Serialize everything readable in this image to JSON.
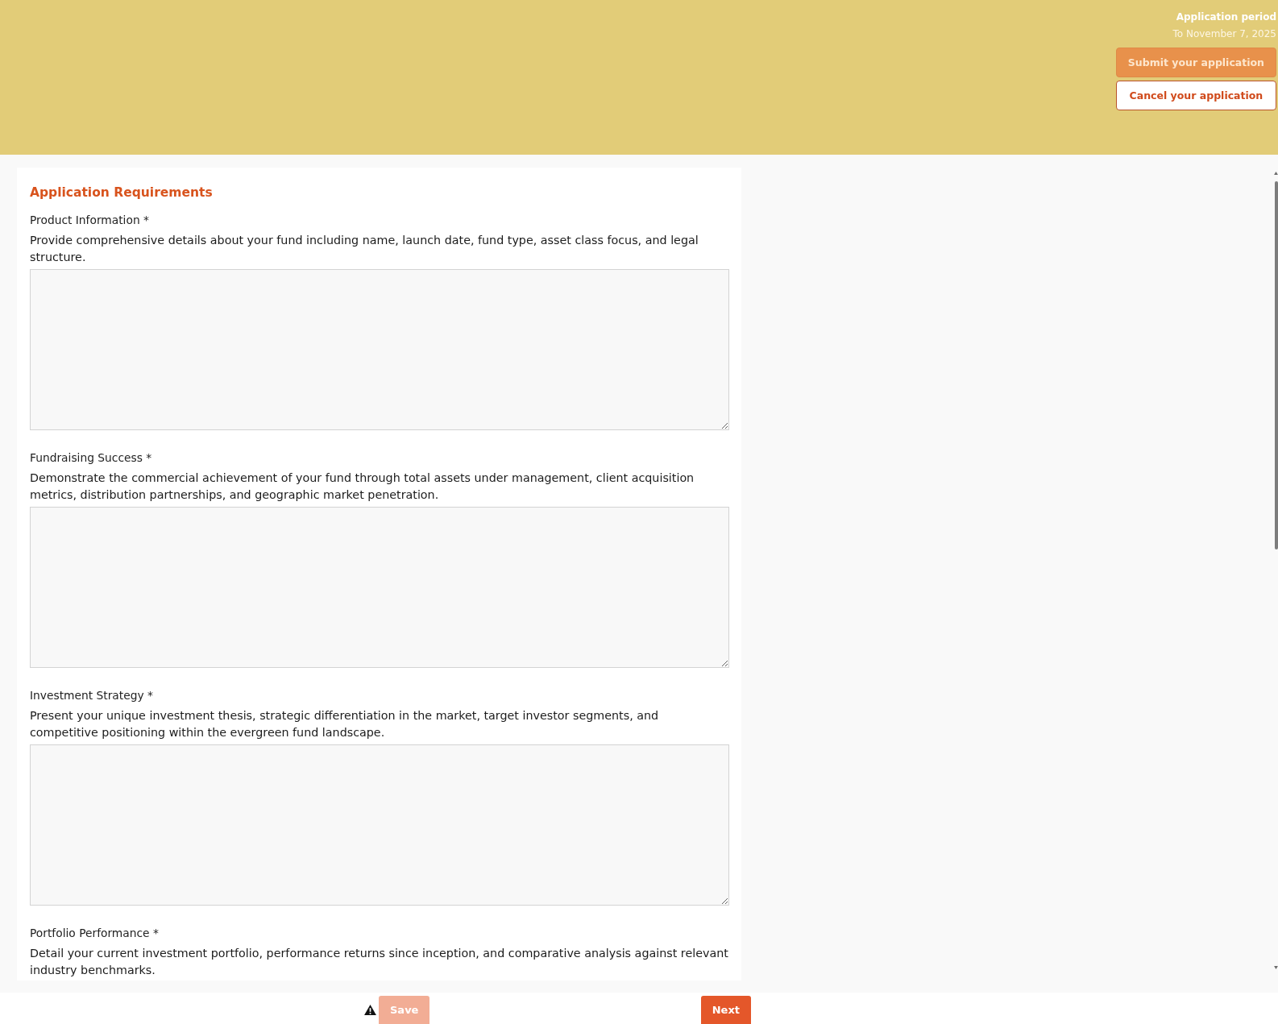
{
  "header": {
    "period_label": "Application period",
    "period_value": "To November 7, 2025",
    "buttons": [
      {
        "label": "Submit your application",
        "kind": "submit",
        "disabled": true
      },
      {
        "label": "Cancel your application",
        "kind": "cancel",
        "disabled": false
      }
    ]
  },
  "form": {
    "title": "Application Requirements",
    "fields": [
      {
        "label": "Product Information *",
        "description": "Provide comprehensive details about your fund including name, launch date, fund type, asset class focus, and legal structure.",
        "answer_box": true
      },
      {
        "label": "Fundraising Success *",
        "description": "Demonstrate the commercial achievement of your fund through total assets under management, client acquisition metrics, distribution partnerships, and geographic market penetration.",
        "answer_box": true
      },
      {
        "label": "Investment Strategy *",
        "description": "Present your unique investment thesis, strategic differentiation in the market, target investor segments, and competitive positioning within the evergreen fund landscape.",
        "answer_box": true
      },
      {
        "label": "Portfolio Performance *",
        "description": "Detail your current investment portfolio, performance returns since inception, and comparative analysis against relevant industry benchmarks.",
        "answer_box": false
      }
    ]
  },
  "footer": {
    "buttons": [
      {
        "label": "Save",
        "kind": "save",
        "disabled": true
      },
      {
        "label": "Next",
        "kind": "next",
        "disabled": false
      }
    ]
  }
}
